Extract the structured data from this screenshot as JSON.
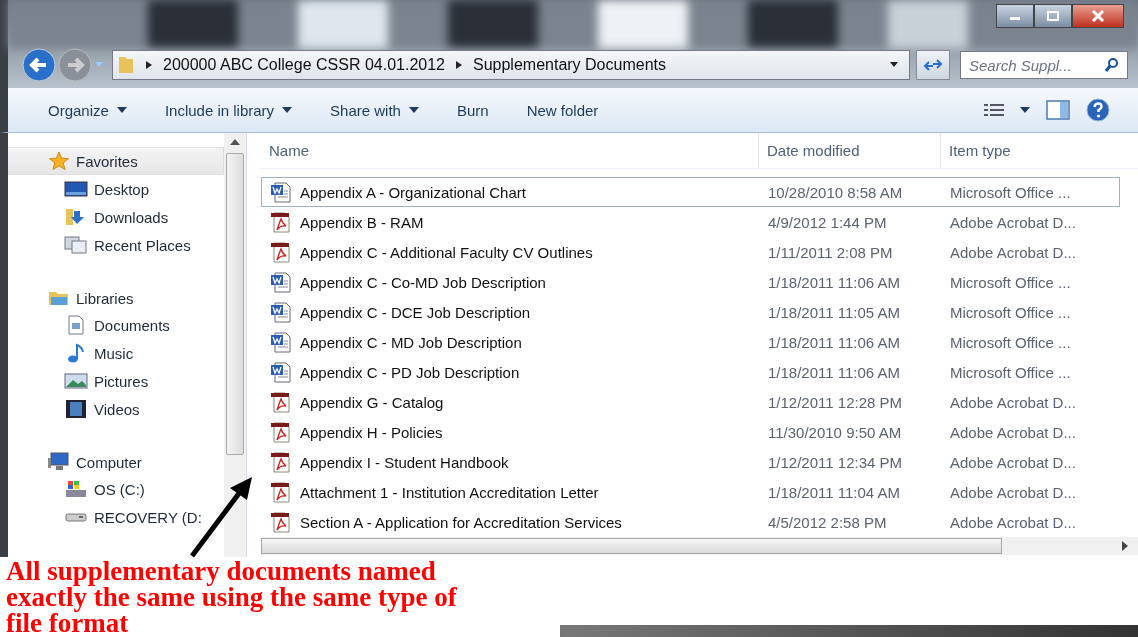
{
  "address": {
    "crumbs": [
      "200000 ABC College CSSR 04.01.2012",
      "Supplementary Documents"
    ]
  },
  "search": {
    "placeholder": "Search Suppl..."
  },
  "toolbar": [
    {
      "label": "Organize",
      "dropdown": true
    },
    {
      "label": "Include in library",
      "dropdown": true
    },
    {
      "label": "Share with",
      "dropdown": true
    },
    {
      "label": "Burn",
      "dropdown": false
    },
    {
      "label": "New folder",
      "dropdown": false
    }
  ],
  "sidebar": {
    "groups": [
      {
        "label": "Favorites",
        "kind": "star",
        "selected": true,
        "children": [
          {
            "label": "Desktop",
            "kind": "desktop"
          },
          {
            "label": "Downloads",
            "kind": "downloads"
          },
          {
            "label": "Recent Places",
            "kind": "recent"
          }
        ]
      },
      {
        "label": "Libraries",
        "kind": "library",
        "selected": false,
        "children": [
          {
            "label": "Documents",
            "kind": "documents"
          },
          {
            "label": "Music",
            "kind": "music"
          },
          {
            "label": "Pictures",
            "kind": "pictures"
          },
          {
            "label": "Videos",
            "kind": "videos"
          }
        ]
      },
      {
        "label": "Computer",
        "kind": "computer",
        "selected": false,
        "children": [
          {
            "label": "OS (C:)",
            "kind": "osdrive"
          },
          {
            "label": "RECOVERY (D:",
            "kind": "drive"
          }
        ]
      }
    ]
  },
  "table": {
    "columns": [
      "Name",
      "Date modified",
      "Item type"
    ],
    "rows": [
      {
        "name": "Appendix A - Organizational Chart",
        "date": "10/28/2010 8:58 AM",
        "type": "Microsoft Office ...",
        "kind": "word",
        "selected": true
      },
      {
        "name": "Appendix B - RAM",
        "date": "4/9/2012 1:44 PM",
        "type": "Adobe Acrobat D...",
        "kind": "pdf",
        "selected": false
      },
      {
        "name": "Appendix C - Additional Faculty CV Outlines",
        "date": "1/11/2011 2:08 PM",
        "type": "Adobe Acrobat D...",
        "kind": "pdf",
        "selected": false
      },
      {
        "name": "Appendix C - Co-MD Job Description",
        "date": "1/18/2011 11:06 AM",
        "type": "Microsoft Office ...",
        "kind": "word",
        "selected": false
      },
      {
        "name": "Appendix C - DCE Job Description",
        "date": "1/18/2011 11:05 AM",
        "type": "Microsoft Office ...",
        "kind": "word",
        "selected": false
      },
      {
        "name": "Appendix C - MD Job Description",
        "date": "1/18/2011 11:06 AM",
        "type": "Microsoft Office ...",
        "kind": "word",
        "selected": false
      },
      {
        "name": "Appendix C - PD Job Description",
        "date": "1/18/2011 11:06 AM",
        "type": "Microsoft Office ...",
        "kind": "word",
        "selected": false
      },
      {
        "name": "Appendix G - Catalog",
        "date": "1/12/2011 12:28 PM",
        "type": "Adobe Acrobat D...",
        "kind": "pdf",
        "selected": false
      },
      {
        "name": "Appendix H - Policies",
        "date": "11/30/2010 9:50 AM",
        "type": "Adobe Acrobat D...",
        "kind": "pdf",
        "selected": false
      },
      {
        "name": "Appendix I - Student Handbook",
        "date": "1/12/2011 12:34 PM",
        "type": "Adobe Acrobat D...",
        "kind": "pdf",
        "selected": false
      },
      {
        "name": "Attachment 1 - Institution Accreditation Letter",
        "date": "1/18/2011 11:04 AM",
        "type": "Adobe Acrobat D...",
        "kind": "pdf",
        "selected": false
      },
      {
        "name": "Section A - Application for Accreditation Services",
        "date": "4/5/2012 2:58 PM",
        "type": "Adobe Acrobat D...",
        "kind": "pdf",
        "selected": false
      }
    ]
  },
  "annotation": {
    "text": "All supplementary documents named exactly the same using the same type of file format"
  }
}
